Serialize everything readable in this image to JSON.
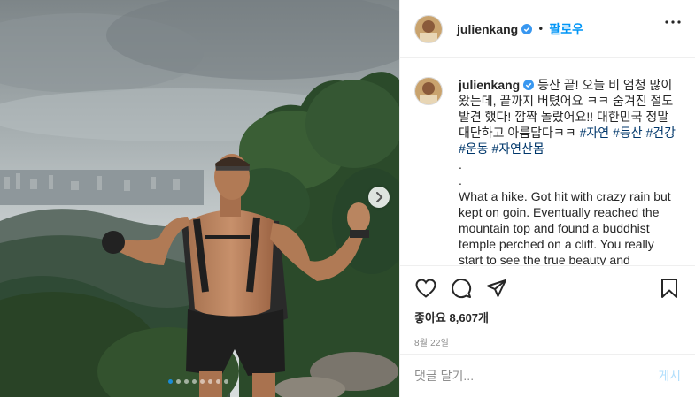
{
  "post": {
    "username": "julienkang",
    "verified": true,
    "follow_label": "팔로우",
    "separator": "•",
    "caption_korean": "등산 끝! 오늘 비 엄청 많이 왔는데, 끝까지 버텼어요 ㅋㅋ 숨겨진 절도 발견 했다! 깜짝 놀랐어요!! 대한민국 정말 대단하고 아름답다ㅋㅋ",
    "hashtags": [
      "#자연",
      "#등산",
      "#건강",
      "#운동",
      "#자연산몸"
    ],
    "dot_lines": [
      ".",
      "."
    ],
    "caption_english": "What a hike. Got hit with crazy rain but kept on goin. Eventually reached the mountain top and found a buddhist temple perched on a cliff. You really start to see the true beauty and",
    "likes_label": "좋아요 8,607개",
    "date": "8월 22일",
    "comment_placeholder": "댓글 달기...",
    "post_label": "게시"
  },
  "carousel": {
    "dots_total": 8,
    "active_index": 0
  },
  "icons": {
    "verified": "verified-badge-icon",
    "more": "more-options-icon",
    "like": "heart-icon",
    "comment": "comment-icon",
    "share": "paper-plane-icon",
    "save": "bookmark-icon",
    "next": "chevron-right-icon"
  },
  "colors": {
    "accent": "#0095f6",
    "hashtag": "#00376b",
    "muted": "#8e8e8e",
    "post_disabled": "#b2dffc",
    "border": "#efefef"
  }
}
